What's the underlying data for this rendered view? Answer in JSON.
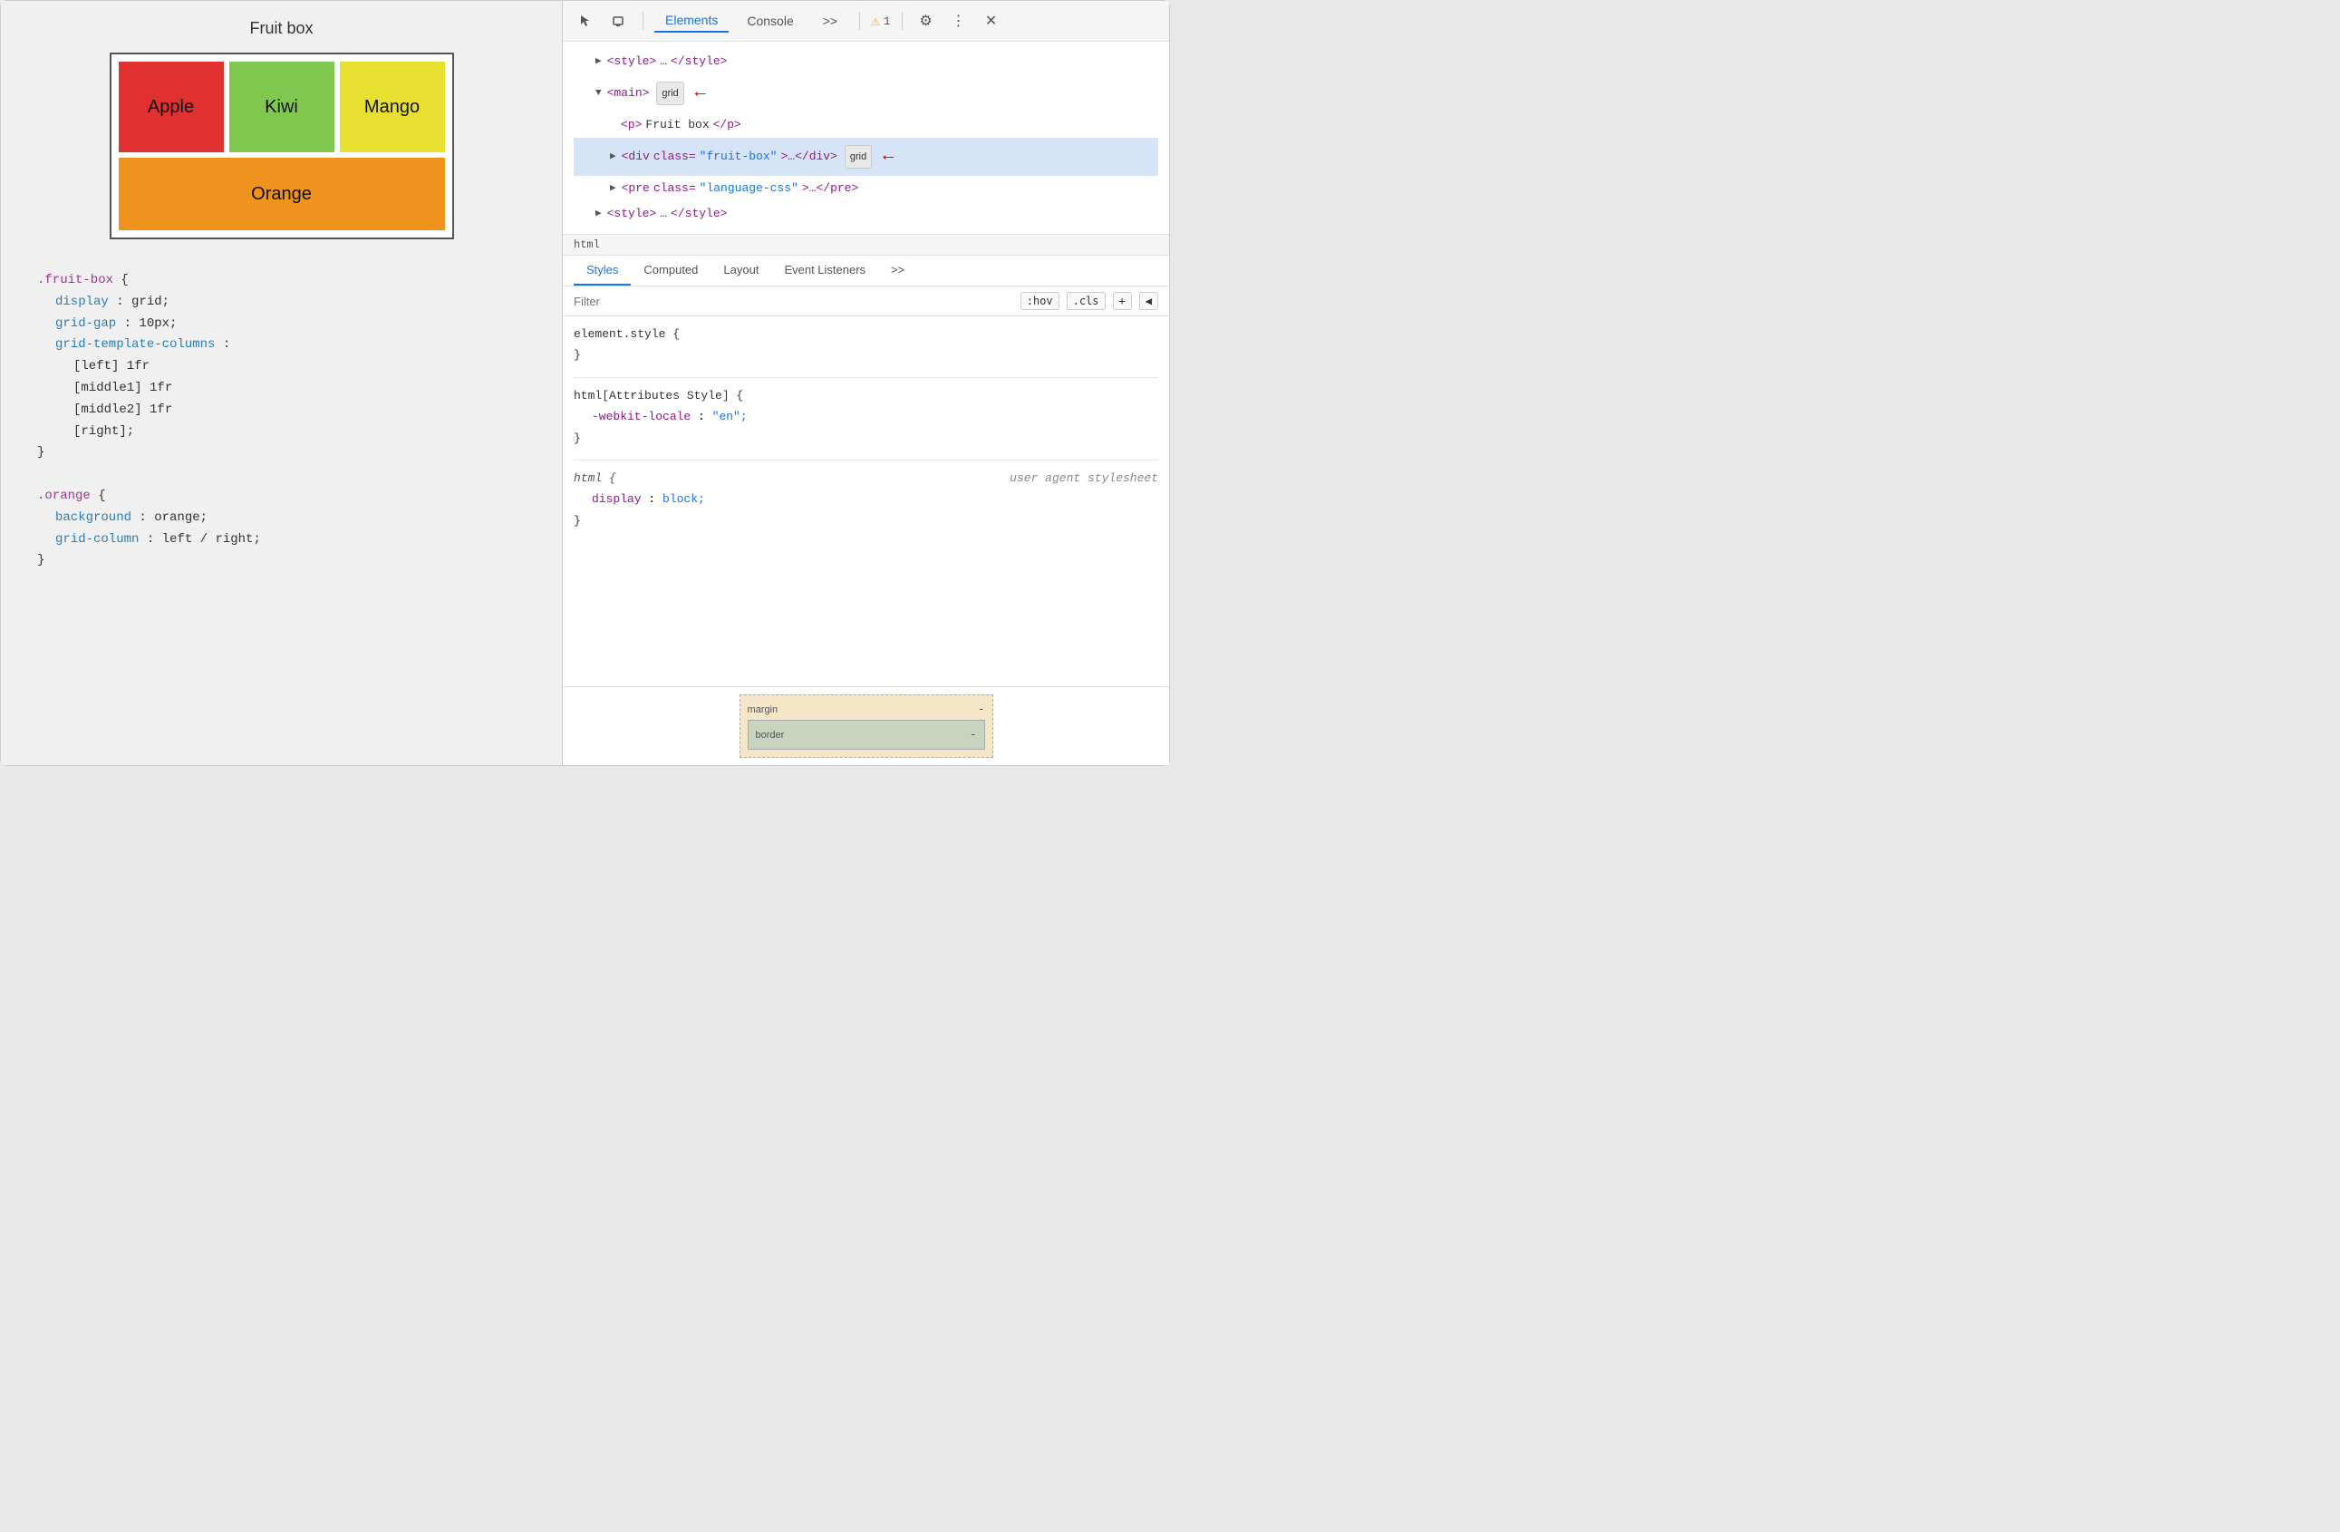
{
  "left": {
    "title": "Fruit box",
    "fruits": [
      {
        "name": "Apple",
        "class": "fruit-apple"
      },
      {
        "name": "Kiwi",
        "class": "fruit-kiwi"
      },
      {
        "name": "Mango",
        "class": "fruit-mango"
      },
      {
        "name": "Orange",
        "class": "fruit-orange"
      }
    ],
    "code_sections": [
      {
        "selector": ".fruit-box",
        "properties": [
          {
            "name": "display",
            "value": "grid;"
          },
          {
            "name": "grid-gap",
            "value": "10px;"
          },
          {
            "name": "grid-template-columns",
            "value": null,
            "multiline": [
              "[left] 1fr",
              "[middle1] 1fr",
              "[middle2] 1fr",
              "[right];"
            ]
          }
        ]
      },
      {
        "selector": ".orange",
        "properties": [
          {
            "name": "background",
            "value": "orange;"
          },
          {
            "name": "grid-column",
            "value": "left / right;"
          }
        ]
      }
    ]
  },
  "devtools": {
    "toolbar": {
      "tabs": [
        "Elements",
        "Console",
        ">>"
      ],
      "active_tab": "Elements",
      "warning_count": "1",
      "icons": [
        "cursor-icon",
        "box-icon",
        "more-tabs-icon",
        "warning-icon",
        "settings-icon",
        "more-icon",
        "close-icon"
      ]
    },
    "dom_tree": {
      "nodes": [
        {
          "indent": 0,
          "collapsed": true,
          "tag": "style",
          "content": "…</style>",
          "badge": null,
          "arrow": "▶",
          "selected": false
        },
        {
          "indent": 0,
          "collapsed": false,
          "tag": "main",
          "content": "",
          "badge": "grid",
          "arrow": "▼",
          "selected": false,
          "red_arrow": true
        },
        {
          "indent": 1,
          "collapsed": true,
          "tag": "p",
          "content": "Fruit box</p>",
          "badge": null,
          "arrow": null,
          "selected": false
        },
        {
          "indent": 1,
          "collapsed": true,
          "tag": "div",
          "attr_name": "class",
          "attr_value": "\"fruit-box\"",
          "content": "…</div>",
          "badge": "grid",
          "arrow": "▶",
          "selected": true,
          "red_arrow": true
        },
        {
          "indent": 1,
          "collapsed": true,
          "tag": "pre",
          "attr_name": "class",
          "attr_value": "\"language-css\"",
          "content": "…</pre>",
          "badge": null,
          "arrow": "▶",
          "selected": false
        },
        {
          "indent": 0,
          "collapsed": true,
          "tag": "style",
          "content": "…</style>",
          "badge": null,
          "arrow": "▶",
          "selected": false
        }
      ]
    },
    "breadcrumb": "html",
    "styles_panel": {
      "tabs": [
        "Styles",
        "Computed",
        "Layout",
        "Event Listeners",
        ">>"
      ],
      "active_tab": "Styles",
      "filter_placeholder": "Filter",
      "filter_buttons": [
        ":hov",
        ".cls",
        "+",
        "◀"
      ],
      "rules": [
        {
          "selector": "element.style {",
          "close": "}",
          "properties": []
        },
        {
          "selector": "html[Attributes Style] {",
          "close": "}",
          "properties": [
            {
              "name": "-webkit-locale",
              "value": "\"en\";"
            }
          ]
        },
        {
          "selector": "html {",
          "close": "}",
          "source": "user agent stylesheet",
          "italic": true,
          "properties": [
            {
              "name": "display",
              "value": "block;"
            }
          ]
        }
      ]
    },
    "box_model": {
      "margin_label": "margin",
      "margin_value": "-",
      "border_label": "border",
      "border_value": "-"
    }
  }
}
